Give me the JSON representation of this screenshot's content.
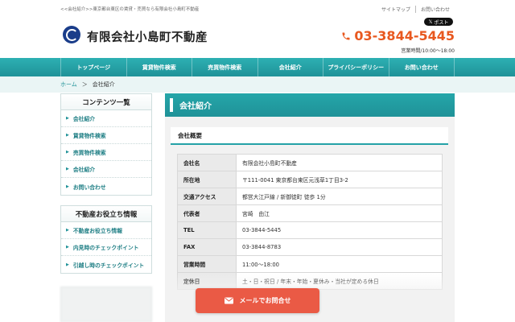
{
  "header": {
    "tagline": "<<会社紹介>>東京都台東区の賃貸・売買なら有限会社小島町不動産",
    "links": [
      "サイトマップ",
      "お問い合わせ"
    ],
    "share_button": "ポスト",
    "company_name": "有限会社小島町不動産",
    "phone": "03-3844-5445",
    "hours": "営業時間/10:00〜18:00"
  },
  "nav": {
    "items": [
      "トップページ",
      "賃貸物件検索",
      "売買物件検索",
      "会社紹介",
      "プライバシーポリシー",
      "お問い合わせ"
    ]
  },
  "breadcrumb": {
    "home": "ホーム",
    "separator": "＞",
    "current": "会社紹介"
  },
  "sidebar": {
    "contents": {
      "title": "コンテンツ一覧",
      "items": [
        "会社紹介",
        "賃貸物件検索",
        "売買物件検索",
        "会社紹介",
        "お問い合わせ"
      ]
    },
    "tips": {
      "title": "不動産お役立ち情報",
      "items": [
        "不動産お役立ち情報",
        "内見時のチェックポイント",
        "引越し時のチェックポイント"
      ]
    }
  },
  "main": {
    "title": "会社紹介",
    "section_title": "会社概要",
    "rows": [
      {
        "key": "会社名",
        "value": "有限会社小島町不動産"
      },
      {
        "key": "所在地",
        "value": "〒111-0041 東京都台東区元浅草1丁目3-2"
      },
      {
        "key": "交通アクセス",
        "value": "都営大江戸線 / 新御徒町 徒歩 1分"
      },
      {
        "key": "代表者",
        "value": "宮崎　由江"
      },
      {
        "key": "TEL",
        "value": "03-3844-5445"
      },
      {
        "key": "FAX",
        "value": "03-3844-8783"
      },
      {
        "key": "営業時間",
        "value": "11:00〜18:00"
      },
      {
        "key": "定休日",
        "value": "土・日・祝日 / 年末・年始・夏休み・当社が定める休日"
      }
    ]
  },
  "floating": {
    "mail_button": "メールでお問合せ"
  },
  "colors": {
    "accent": "#24a2a7",
    "phone": "#e8581f",
    "mail_button": "#ea5a45"
  }
}
